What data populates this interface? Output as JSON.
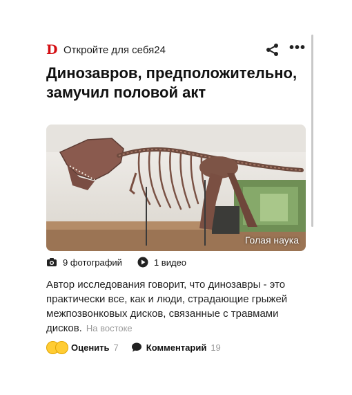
{
  "header": {
    "logo_letter": "D",
    "source_name": "Откройте для себя24",
    "share_icon": "share-icon",
    "more_icon": "more-icon"
  },
  "article": {
    "title": "Динозавров, предположительно, замучил половой акт",
    "image_watermark": "Голая наука",
    "photos_label": "9 фотографий",
    "video_label": "1 видео",
    "description": "Автор исследования говорит, что динозавры - это практически все, как и люди, страдающие грыжей межпозвонковых дисков, связанные с травмами дисков.",
    "source_tag": "На востоке"
  },
  "actions": {
    "rate_label": "Оценить",
    "rate_count": "7",
    "comment_label": "Комментарий",
    "comment_count": "19"
  },
  "colors": {
    "brand": "#d40d12",
    "muted": "#9a9a9a"
  }
}
